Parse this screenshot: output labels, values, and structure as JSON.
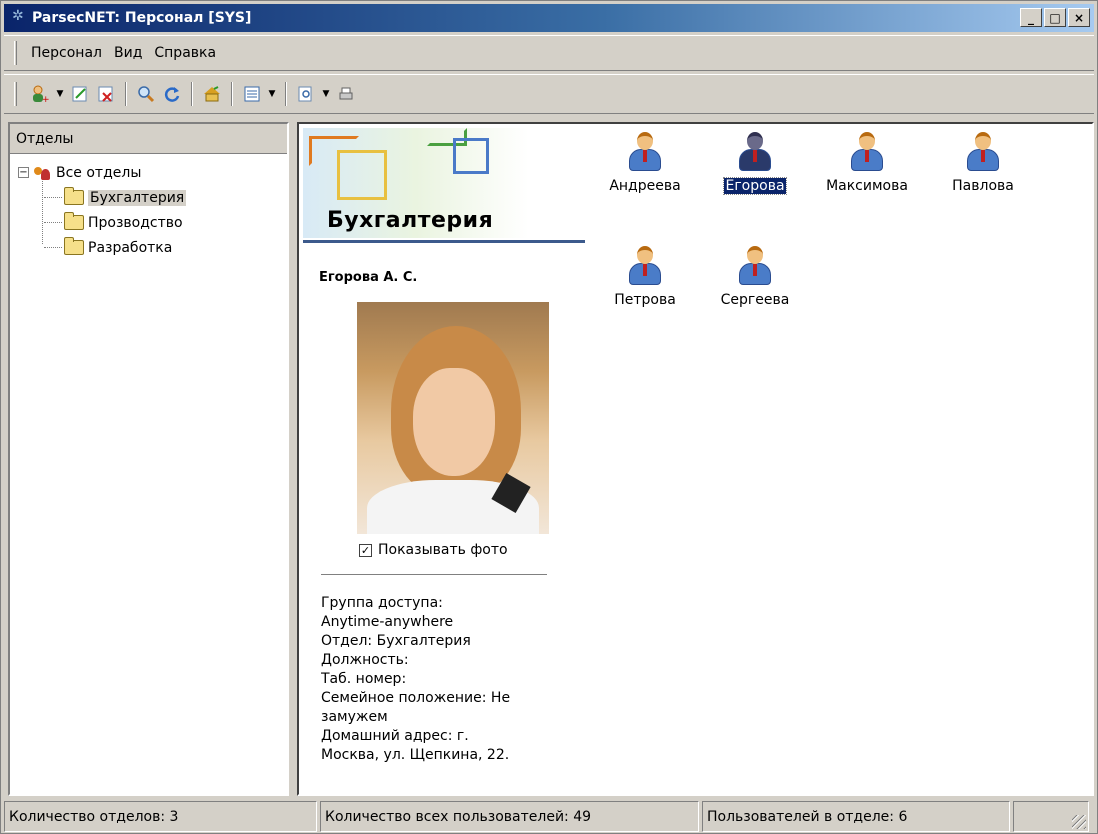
{
  "window": {
    "title": "ParsecNET: Персонал [SYS]",
    "minimize_glyph": "_",
    "maximize_glyph": "□",
    "close_glyph": "×"
  },
  "menu": [
    {
      "label": "Персонал"
    },
    {
      "label": "Вид"
    },
    {
      "label": "Справка"
    }
  ],
  "toolbar": {
    "icons": [
      "add-user-icon",
      "edit-icon",
      "delete-icon",
      "search-icon",
      "refresh-icon",
      "home-icon",
      "view-list-icon",
      "preview-icon",
      "print-icon"
    ]
  },
  "left_pane": {
    "header": "Отделы",
    "tree": {
      "root": {
        "label": "Все отделы",
        "expander": "−"
      },
      "children": [
        {
          "label": "Бухгалтерия",
          "selected": true
        },
        {
          "label": "Прозводство",
          "selected": false
        },
        {
          "label": "Разработка",
          "selected": false
        }
      ]
    }
  },
  "detail": {
    "department_title": "Бухгалтерия",
    "person_name": "Егорова А. С.",
    "show_photo_label": "Показывать фото",
    "show_photo_checked": true,
    "check_glyph": "✓",
    "info_lines": [
      "Группа доступа:",
      "Anytime-anywhere",
      "Отдел: Бухгалтерия",
      "Должность:",
      "Таб. номер:",
      "Семейное положение: Не",
      "замужем",
      "Домашний адрес: г.",
      "Москва, ул. Щепкина, 22."
    ]
  },
  "people": [
    {
      "name": "Андреева",
      "selected": false
    },
    {
      "name": "Егорова",
      "selected": true
    },
    {
      "name": "Максимова",
      "selected": false
    },
    {
      "name": "Павлова",
      "selected": false
    },
    {
      "name": "Петрова",
      "selected": false
    },
    {
      "name": "Сергеева",
      "selected": false
    }
  ],
  "status": {
    "departments": "Количество отделов: 3",
    "all_users": "Количество всех пользователей: 49",
    "dept_users": "Пользователей в отделе: 6"
  }
}
